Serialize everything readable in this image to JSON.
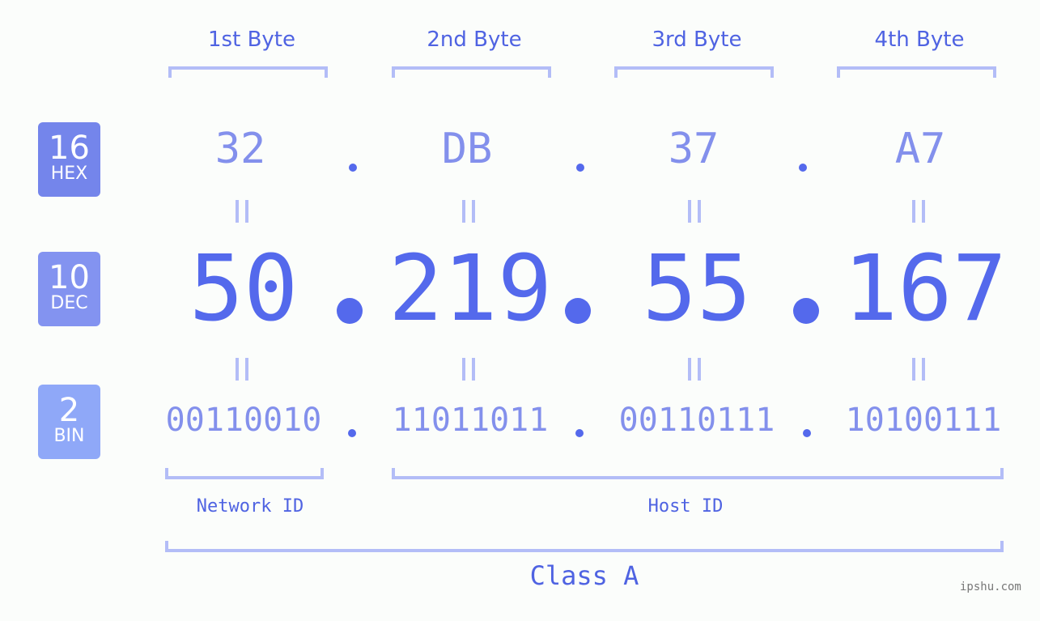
{
  "bytes": [
    {
      "label": "1st Byte",
      "hex": "32",
      "dec": "50",
      "bin": "00110010"
    },
    {
      "label": "2nd Byte",
      "hex": "DB",
      "dec": "219",
      "bin": "11011011"
    },
    {
      "label": "3rd Byte",
      "hex": "37",
      "dec": "55",
      "bin": "00110111"
    },
    {
      "label": "4th Byte",
      "hex": "A7",
      "dec": "167",
      "bin": "10100111"
    }
  ],
  "bases": {
    "hex": {
      "num": "16",
      "label": "HEX",
      "color": "#7485eb"
    },
    "dec": {
      "num": "10",
      "label": "DEC",
      "color": "#8393f0"
    },
    "bin": {
      "num": "2",
      "label": "BIN",
      "color": "#8fa8f8"
    }
  },
  "separator": ".",
  "equals": "=",
  "network_id_label": "Network ID",
  "host_id_label": "Host ID",
  "class_label": "Class A",
  "watermark": "ipshu.com",
  "colors": {
    "primary": "#5469ec",
    "light": "#8390ec",
    "bracket": "#b3bdf7",
    "background": "#fbfdfb"
  }
}
